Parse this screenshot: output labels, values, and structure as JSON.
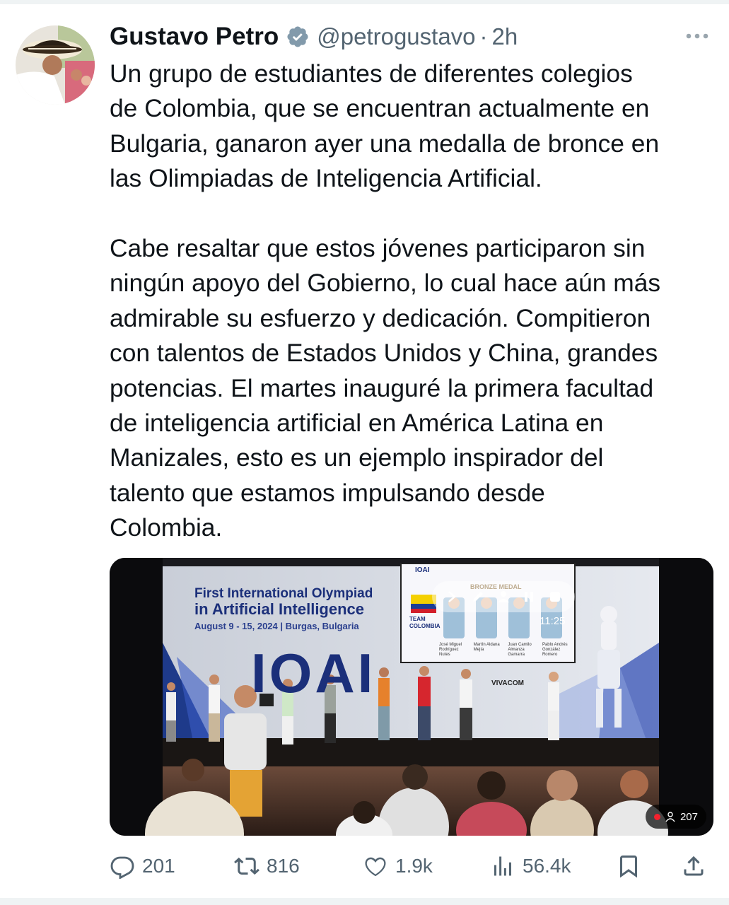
{
  "author": {
    "display_name": "Gustavo Petro",
    "handle": "@petrogustavo",
    "separator": "·",
    "time": "2h",
    "verified_icon": "verified-badge-icon",
    "more_icon": "more-horizontal-icon"
  },
  "tweet": {
    "paragraph_1": "Un grupo de estudiantes de diferentes colegios\nde Colombia, que se encuentran actualmente en\nBulgaria, ganaron ayer una medalla de bronce en\nlas Olimpiadas de Inteligencia Artificial.",
    "paragraph_2": "Cabe resaltar que estos jóvenes participaron sin\nningún apoyo del Gobierno, lo cual hace aún más\nadmirable su esfuerzo y dedicación. Compitieron\ncon talentos de Estados Unidos y China, grandes\npotencias. El martes inauguré la primera facultad\nde inteligencia artificial en América Latina en\nManizales, esto es un ejemplo inspirador del\ntalento que estamos impulsando desde\nColombia."
  },
  "media": {
    "banner_line_1": "First International Olympiad",
    "banner_line_2": "in Artificial Intelligence",
    "banner_line_3": "August 9 - 15, 2024 | Burgas, Bulgaria",
    "logo_text": "IOAI",
    "screen_header": "IOAI",
    "screen_medal": "BRONZE MEDAL",
    "screen_team": "TEAM COLOMBIA",
    "screen_names": [
      "José Miguel Rodríguez Nutes",
      "Martín Aldana Mejía",
      "Juan Camilo Almanza Gamarra",
      "Pablo Andrés González Romero"
    ],
    "sponsor_text": "VIVACOM",
    "video_time": "11:25",
    "viewer_count": "207",
    "controls": [
      "chevron-right-icon",
      "pencil-icon",
      "person-icon",
      "pause-icon",
      "stop-icon"
    ]
  },
  "actions": {
    "replies": "201",
    "reposts": "816",
    "likes": "1.9k",
    "views": "56.4k",
    "icons": [
      "reply-icon",
      "repost-icon",
      "like-icon",
      "views-icon",
      "bookmark-icon",
      "share-icon"
    ]
  },
  "colors": {
    "text": "#0f1419",
    "muted": "#536471",
    "verified_gray": "#829aab",
    "live_red": "#f4212e"
  }
}
